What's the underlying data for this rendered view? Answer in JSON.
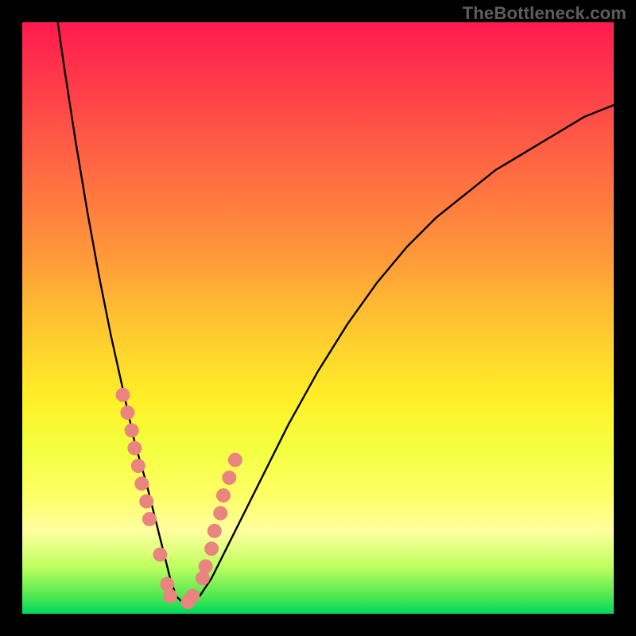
{
  "watermark": "TheBottleneck.com",
  "chart_data": {
    "type": "line",
    "title": "",
    "xlabel": "",
    "ylabel": "",
    "xlim": [
      0,
      100
    ],
    "ylim": [
      0,
      100
    ],
    "grid": false,
    "series": [
      {
        "name": "curve",
        "x": [
          6,
          7,
          9,
          11,
          13,
          15,
          17,
          19,
          21,
          22,
          23,
          24,
          25,
          26,
          27,
          28,
          30,
          32,
          35,
          40,
          45,
          50,
          55,
          60,
          65,
          70,
          75,
          80,
          85,
          90,
          95,
          100
        ],
        "y": [
          100,
          93,
          80,
          68,
          57,
          47,
          38,
          29,
          22,
          18,
          14,
          10,
          6,
          3,
          2,
          2,
          3,
          6,
          12,
          22,
          32,
          41,
          49,
          56,
          62,
          67,
          71,
          75,
          78,
          81,
          84,
          86
        ]
      }
    ],
    "points": {
      "name": "markers",
      "x": [
        17.0,
        17.8,
        18.5,
        19.0,
        19.6,
        20.2,
        21.0,
        21.5,
        23.3,
        24.5,
        25.0,
        28.0,
        28.8,
        30.5,
        31.0,
        32.0,
        32.5,
        33.5,
        34.0,
        35.0,
        36.0
      ],
      "y": [
        37,
        34,
        31,
        28,
        25,
        22,
        19,
        16,
        10,
        5,
        3,
        2,
        3,
        6,
        8,
        11,
        14,
        17,
        20,
        23,
        26
      ],
      "color": "#e9847f",
      "radius": 9
    },
    "stroke_color": "#000000",
    "stroke_width": 2.4,
    "background_gradient": [
      "#ff1a4f",
      "#ffba33",
      "#fff028",
      "#00d860"
    ]
  }
}
